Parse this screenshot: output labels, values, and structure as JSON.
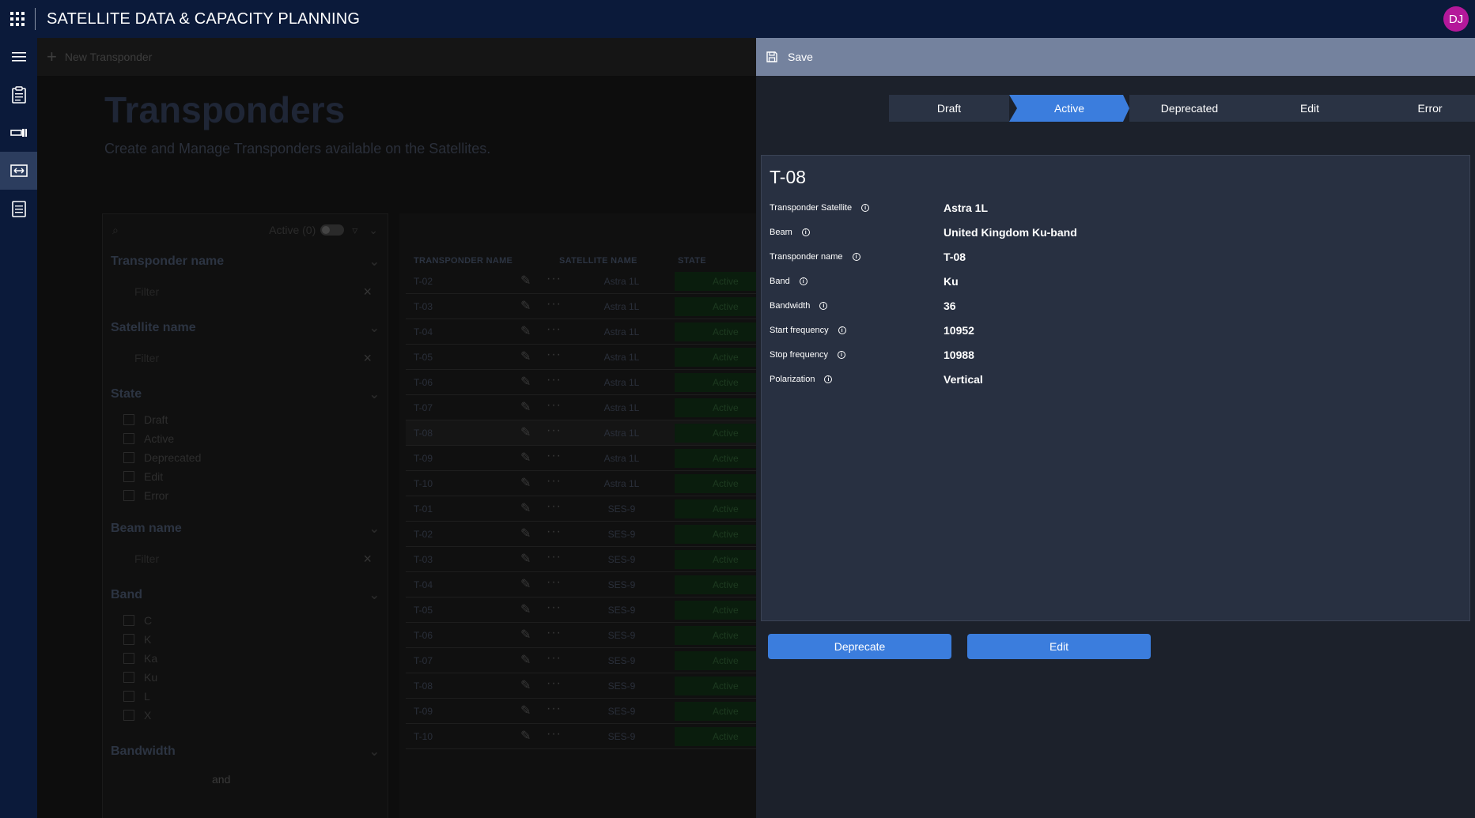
{
  "app": {
    "title": "SATELLITE DATA & CAPACITY PLANNING",
    "user_initials": "DJ"
  },
  "background": {
    "command": {
      "new_label": "New Transponder"
    },
    "page_title": "Transponders",
    "page_subtitle": "Create and Manage Transponders available on the Satellites.",
    "filters": {
      "active_toggle_label": "Active (0)",
      "transponder_name": {
        "label": "Transponder name",
        "placeholder": "Filter"
      },
      "satellite_name": {
        "label": "Satellite name",
        "placeholder": "Filter"
      },
      "state": {
        "label": "State",
        "options": [
          "Draft",
          "Active",
          "Deprecated",
          "Edit",
          "Error"
        ]
      },
      "beam_name": {
        "label": "Beam name",
        "placeholder": "Filter"
      },
      "band": {
        "label": "Band",
        "options": [
          "C",
          "K",
          "Ka",
          "Ku",
          "L",
          "X"
        ]
      },
      "bandwidth": {
        "label": "Bandwidth",
        "between": "and"
      }
    },
    "table": {
      "headers": {
        "name": "TRANSPONDER NAME",
        "satellite": "SATELLITE NAME",
        "state": "STATE"
      },
      "rows": [
        {
          "name": "T-02",
          "satellite": "Astra 1L",
          "state": "Active"
        },
        {
          "name": "T-03",
          "satellite": "Astra 1L",
          "state": "Active"
        },
        {
          "name": "T-04",
          "satellite": "Astra 1L",
          "state": "Active"
        },
        {
          "name": "T-05",
          "satellite": "Astra 1L",
          "state": "Active"
        },
        {
          "name": "T-06",
          "satellite": "Astra 1L",
          "state": "Active"
        },
        {
          "name": "T-07",
          "satellite": "Astra 1L",
          "state": "Active"
        },
        {
          "name": "T-08",
          "satellite": "Astra 1L",
          "state": "Active"
        },
        {
          "name": "T-09",
          "satellite": "Astra 1L",
          "state": "Active"
        },
        {
          "name": "T-10",
          "satellite": "Astra 1L",
          "state": "Active"
        },
        {
          "name": "T-01",
          "satellite": "SES-9",
          "state": "Active"
        },
        {
          "name": "T-02",
          "satellite": "SES-9",
          "state": "Active"
        },
        {
          "name": "T-03",
          "satellite": "SES-9",
          "state": "Active"
        },
        {
          "name": "T-04",
          "satellite": "SES-9",
          "state": "Active"
        },
        {
          "name": "T-05",
          "satellite": "SES-9",
          "state": "Active"
        },
        {
          "name": "T-06",
          "satellite": "SES-9",
          "state": "Active"
        },
        {
          "name": "T-07",
          "satellite": "SES-9",
          "state": "Active"
        },
        {
          "name": "T-08",
          "satellite": "SES-9",
          "state": "Active"
        },
        {
          "name": "T-09",
          "satellite": "SES-9",
          "state": "Active"
        },
        {
          "name": "T-10",
          "satellite": "SES-9",
          "state": "Active"
        }
      ]
    }
  },
  "panel": {
    "save_label": "Save",
    "stages": [
      "Draft",
      "Active",
      "Deprecated",
      "Edit",
      "Error"
    ],
    "active_stage": "Active",
    "title": "T-08",
    "fields": [
      {
        "label": "Transponder Satellite",
        "value": "Astra 1L"
      },
      {
        "label": "Beam",
        "value": "United Kingdom Ku-band"
      },
      {
        "label": "Transponder name",
        "value": "T-08"
      },
      {
        "label": "Band",
        "value": "Ku"
      },
      {
        "label": "Bandwidth",
        "value": "36"
      },
      {
        "label": "Start frequency",
        "value": "10952"
      },
      {
        "label": "Stop frequency",
        "value": "10988"
      },
      {
        "label": "Polarization",
        "value": "Vertical"
      }
    ],
    "deprecate_label": "Deprecate",
    "edit_label": "Edit"
  },
  "colors": {
    "topbar": "#0b1a3a",
    "accent": "#3b7ddd",
    "panel": "#1c212b",
    "card": "#283041",
    "avatar": "#b4189a"
  }
}
